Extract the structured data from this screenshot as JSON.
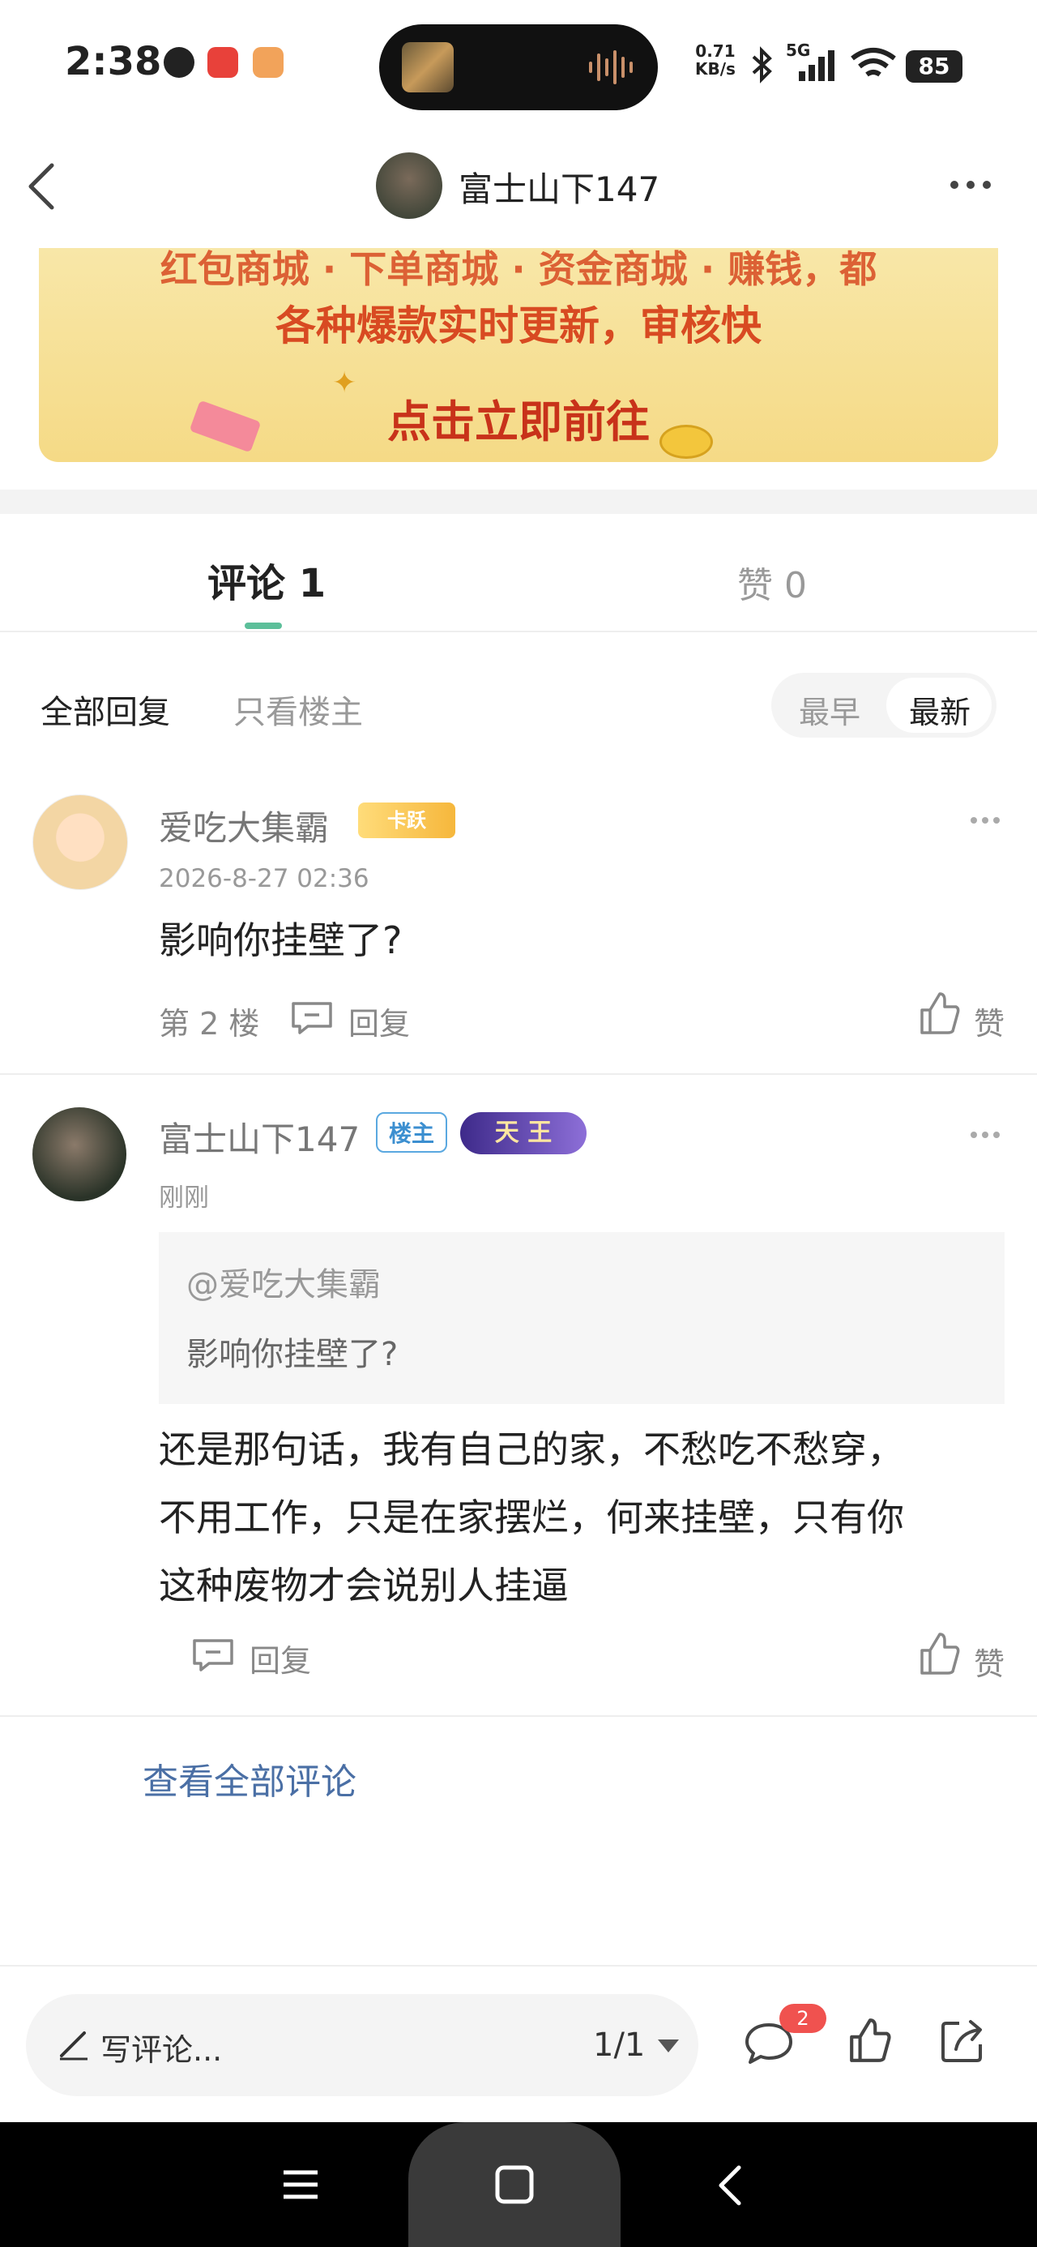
{
  "status_bar": {
    "time": "2:38",
    "net_speed_value": "0.71",
    "net_speed_unit": "KB/s",
    "network": "5G",
    "battery": "85"
  },
  "header": {
    "title": "富士山下147"
  },
  "banner": {
    "line1": "红包商城 · 下单商城 · 资金商城 · 赚钱，都",
    "line2": "各种爆款实时更新，审核快",
    "cta": "点击立即前往"
  },
  "tabs": [
    {
      "label": "评论 1"
    },
    {
      "label": "赞 0"
    }
  ],
  "filters": {
    "all": "全部回复",
    "op_only": "只看楼主",
    "sort_earliest": "最早",
    "sort_latest": "最新"
  },
  "comments": [
    {
      "username": "爱吃大集霸",
      "badge": "卡跃",
      "time": "2026-8-27 02:36",
      "text": "影响你挂壁了?",
      "floor": "第 2 楼",
      "reply_label": "回复",
      "like_label": "赞"
    },
    {
      "username": "富士山下147",
      "op_badge": "楼主",
      "level_badge": "天 王",
      "time": "刚刚",
      "quote_user": "@爱吃大集霸",
      "quote_text": "影响你挂壁了?",
      "text_lines": [
        "还是那句话，我有自己的家，不愁吃不愁穿，",
        "不用工作，只是在家摆烂，何来挂壁，只有你",
        "这种废物才会说别人挂逼"
      ],
      "reply_label": "回复",
      "like_label": "赞"
    }
  ],
  "view_all": "查看全部评论",
  "bottom_bar": {
    "placeholder": "写评论...",
    "page": "1/1",
    "comment_count": "2"
  },
  "colors": {
    "accent_green": "#5cbf9a",
    "link_blue": "#4a6fa5",
    "badge_red": "#f0524f"
  }
}
